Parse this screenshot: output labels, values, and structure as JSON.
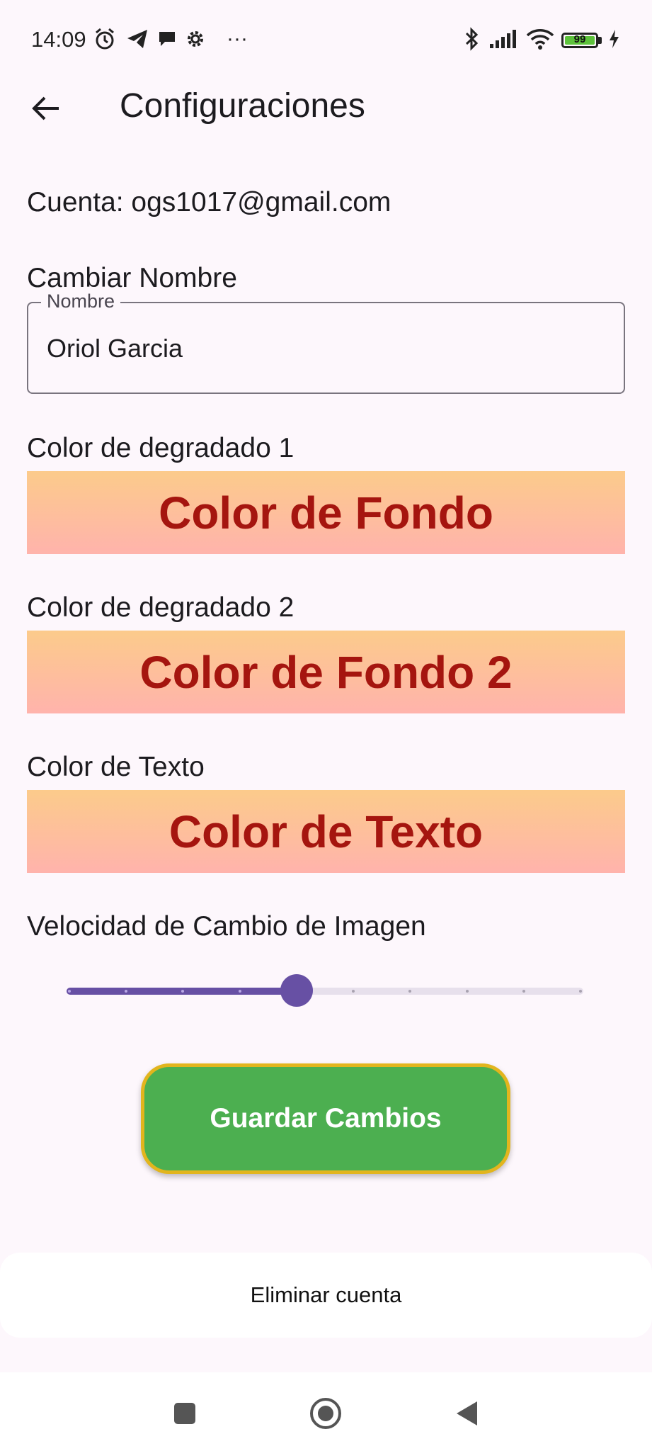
{
  "status_bar": {
    "time": "14:09",
    "more": "···",
    "battery_level": "99",
    "icons": [
      "alarm-icon",
      "telegram-icon",
      "chat-bubble-icon",
      "settings-gear-icon",
      "bluetooth-icon",
      "signal-icon",
      "wifi-icon",
      "battery-icon",
      "charging-icon"
    ]
  },
  "app_bar": {
    "title": "Configuraciones",
    "back_icon": "arrow-left-icon"
  },
  "account": {
    "text": "Cuenta: ogs1017@gmail.com"
  },
  "name_section": {
    "heading": "Cambiar Nombre",
    "field_label": "Nombre",
    "field_value": "Oriol Garcia"
  },
  "gradient_1": {
    "label": "Color de degradado 1",
    "button": "Color de Fondo"
  },
  "gradient_2": {
    "label": "Color de degradado 2",
    "button": "Color de Fondo 2"
  },
  "text_color": {
    "label": "Color de Texto",
    "button": "Color de Texto"
  },
  "speed": {
    "label": "Velocidad de Cambio de Imagen",
    "slider_value": 4,
    "slider_min": 0,
    "slider_max": 9
  },
  "save_button": "Guardar Cambios",
  "delete_account": "Eliminar cuenta",
  "colors": {
    "accent": "#6750a4",
    "save_button": "#4caf50",
    "save_border": "#e2b51d",
    "gradient_top": "#fccb8b",
    "gradient_bottom": "#ffb3ac",
    "button_text": "#a5150f",
    "background": "#fdf7fc"
  },
  "nav_bar": {
    "icons": [
      "recent-apps-icon",
      "home-icon",
      "back-triangle-icon"
    ]
  }
}
